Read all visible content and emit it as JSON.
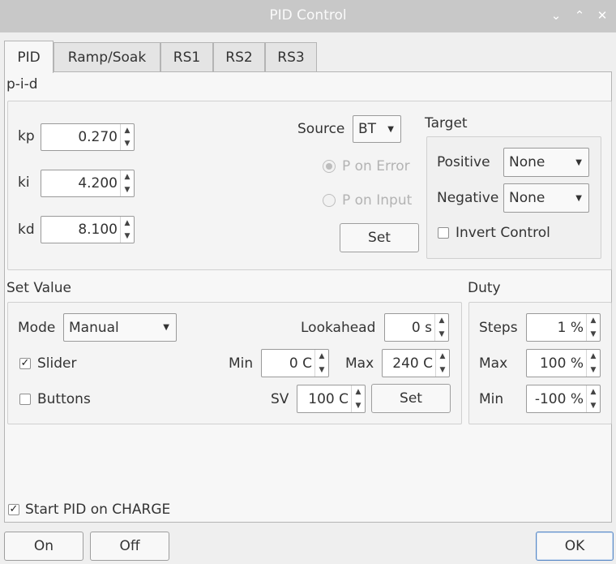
{
  "window": {
    "title": "PID Control",
    "controls": [
      "chevron-down-icon",
      "chevron-up-icon",
      "close-icon"
    ],
    "control_glyphs": [
      "⌄",
      "⌃",
      "✕"
    ]
  },
  "tabs": [
    {
      "label": "PID",
      "active": true
    },
    {
      "label": "Ramp/Soak"
    },
    {
      "label": "RS1"
    },
    {
      "label": "RS2"
    },
    {
      "label": "RS3"
    }
  ],
  "pid": {
    "group_label": "p-i-d",
    "kp": {
      "label": "kp",
      "value": "0.270"
    },
    "ki": {
      "label": "ki",
      "value": "4.200"
    },
    "kd": {
      "label": "kd",
      "value": "8.100"
    },
    "source": {
      "label": "Source",
      "value": "BT"
    },
    "p_on_error": {
      "label": "P on Error",
      "checked": true
    },
    "p_on_input": {
      "label": "P on Input",
      "checked": false
    },
    "set_label": "Set"
  },
  "target": {
    "group_label": "Target",
    "positive": {
      "label": "Positive",
      "value": "None"
    },
    "negative": {
      "label": "Negative",
      "value": "None"
    },
    "invert": {
      "label": "Invert Control",
      "checked": false
    }
  },
  "set_value": {
    "group_label": "Set Value",
    "mode": {
      "label": "Mode",
      "value": "Manual"
    },
    "lookahead": {
      "label": "Lookahead",
      "value": "0 s"
    },
    "slider": {
      "label": "Slider",
      "checked": true
    },
    "buttons": {
      "label": "Buttons",
      "checked": false
    },
    "min": {
      "label": "Min",
      "value": "0 C"
    },
    "max": {
      "label": "Max",
      "value": "240 C"
    },
    "sv": {
      "label": "SV",
      "value": "100 C"
    },
    "set_label": "Set"
  },
  "duty": {
    "group_label": "Duty",
    "steps": {
      "label": "Steps",
      "value": "1 %"
    },
    "max": {
      "label": "Max",
      "value": "100 %"
    },
    "min": {
      "label": "Min",
      "value": "-100 %"
    }
  },
  "start_on_charge": {
    "label": "Start PID on CHARGE",
    "checked": true
  },
  "footer": {
    "on_label": "On",
    "off_label": "Off",
    "ok_label": "OK"
  },
  "glyphs": {
    "check": "✓",
    "spin_up": "▲",
    "spin_down": "▼",
    "combo_arrow": "▼"
  },
  "colors": {
    "default_button_border": "#5a8ac6",
    "titlebar": "#c8c8c8",
    "panel": "#f7f7f7"
  }
}
